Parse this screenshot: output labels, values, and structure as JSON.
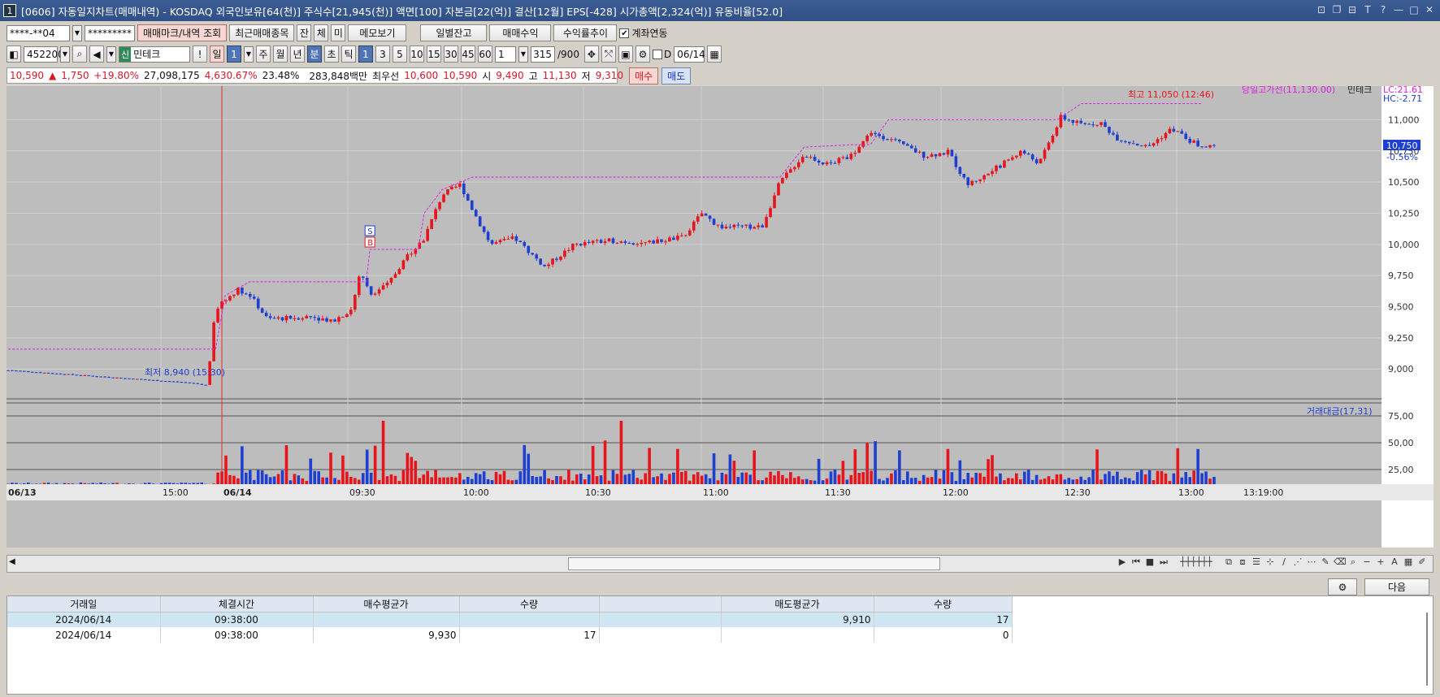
{
  "window": {
    "number": "1",
    "title": "[0606] 자동일지차트(매매내역) - KOSDAQ 외국인보유[64(천)] 주식수[21,945(천)] 액면[100] 자본금[22(억)] 결산[12월] EPS[-428] 시가총액[2,324(억)] 유동비율[52.0]"
  },
  "toolbar1": {
    "account": "****-**04",
    "password": "*********",
    "btn_mark": "매매마크/내역 조회",
    "btn_recent": "최근매매종목",
    "btn_jan": "잔",
    "btn_che": "체",
    "btn_mi": "미",
    "btn_memo": "메모보기",
    "btn_daily": "일별잔고",
    "btn_profit": "매매수익",
    "btn_rate": "수익률추이",
    "chk_link": "계좌연동"
  },
  "toolbar2": {
    "code": "452200",
    "badge": "신",
    "name": "민테크",
    "excl": "!",
    "day": "일",
    "day_n": "1",
    "week": "주",
    "month": "월",
    "year": "년",
    "minute": "분",
    "sec": "초",
    "tick": "틱",
    "periods": [
      "1",
      "3",
      "5",
      "10",
      "15",
      "30",
      "45",
      "60"
    ],
    "count_sel": "1",
    "count": "315",
    "count_max": "/900",
    "d_label": "D",
    "date": "06/14"
  },
  "quote": {
    "price": "10,590",
    "arrow": "▲",
    "change": "1,750",
    "pct": "+19.80%",
    "volume": "27,098,175",
    "vol_pct": "4,630.67%",
    "turnover": "23.48%",
    "amount": "283,848백만",
    "best_label": "최우선",
    "ask": "10,600",
    "bid": "10,590",
    "open_label": "시",
    "open": "9,490",
    "high_label": "고",
    "high": "11,130",
    "low_label": "저",
    "low": "9,310",
    "buy": "매수",
    "sell": "매도"
  },
  "chart_data": {
    "type": "candlestick",
    "times": [
      "06/13",
      "15:00",
      "06/14",
      "09:30",
      "10:00",
      "10:30",
      "11:00",
      "11:30",
      "12:00",
      "12:30",
      "13:00",
      "13:19:00"
    ],
    "yticks": [
      "11,000",
      "10,750",
      "10,500",
      "10,250",
      "10,000",
      "9,750",
      "9,500",
      "9,250",
      "9,000"
    ],
    "ylim": [
      8780,
      11270
    ],
    "path": [
      [
        0,
        8990
      ],
      [
        0.09,
        8930
      ],
      [
        0.15,
        8890
      ],
      [
        0.165,
        8870
      ],
      [
        0.172,
        9480
      ],
      [
        0.19,
        9640
      ],
      [
        0.2,
        9600
      ],
      [
        0.215,
        9400
      ],
      [
        0.25,
        9420
      ],
      [
        0.27,
        9390
      ],
      [
        0.285,
        9480
      ],
      [
        0.292,
        9790
      ],
      [
        0.3,
        9600
      ],
      [
        0.315,
        9680
      ],
      [
        0.33,
        9900
      ],
      [
        0.345,
        10050
      ],
      [
        0.36,
        10400
      ],
      [
        0.375,
        10480
      ],
      [
        0.385,
        10280
      ],
      [
        0.4,
        10000
      ],
      [
        0.42,
        10050
      ],
      [
        0.445,
        9820
      ],
      [
        0.47,
        10000
      ],
      [
        0.5,
        10030
      ],
      [
        0.53,
        10010
      ],
      [
        0.56,
        10060
      ],
      [
        0.575,
        10250
      ],
      [
        0.59,
        10140
      ],
      [
        0.625,
        10140
      ],
      [
        0.64,
        10500
      ],
      [
        0.66,
        10720
      ],
      [
        0.68,
        10640
      ],
      [
        0.7,
        10720
      ],
      [
        0.715,
        10900
      ],
      [
        0.73,
        10850
      ],
      [
        0.76,
        10710
      ],
      [
        0.78,
        10740
      ],
      [
        0.795,
        10480
      ],
      [
        0.81,
        10550
      ],
      [
        0.84,
        10750
      ],
      [
        0.855,
        10650
      ],
      [
        0.873,
        11020
      ],
      [
        0.89,
        10960
      ],
      [
        0.905,
        10980
      ],
      [
        0.92,
        10850
      ],
      [
        0.945,
        10780
      ],
      [
        0.965,
        10930
      ],
      [
        0.98,
        10830
      ],
      [
        0.99,
        10780
      ]
    ],
    "volume_axis": [
      "75,00",
      "50,00",
      "25,00"
    ],
    "volume_label": "거래대금(17,31)",
    "hi_label": "최고 11,050 (12:46)",
    "lo_label": "최저 8,940 (15:30)",
    "hiline_label": "당일고가선(11,130.00)",
    "name_label": "민테크",
    "lc": "LC:21.61",
    "hc": "HC:-2.71",
    "last": "10,750",
    "last_pct": "-0.56%",
    "marker_s": "S",
    "marker_b": "B"
  },
  "grid": {
    "headers": [
      "거래일",
      "체결시간",
      "매수평균가",
      "수량",
      "",
      "매도평균가",
      "수량"
    ],
    "rows": [
      [
        "2024/06/14",
        "09:38:00",
        "",
        "",
        "",
        "9,910",
        "17"
      ],
      [
        "2024/06/14",
        "09:38:00",
        "9,930",
        "17",
        "",
        "",
        "0"
      ]
    ]
  },
  "buttons": {
    "settings_icon": "⚙",
    "next": "다음"
  }
}
